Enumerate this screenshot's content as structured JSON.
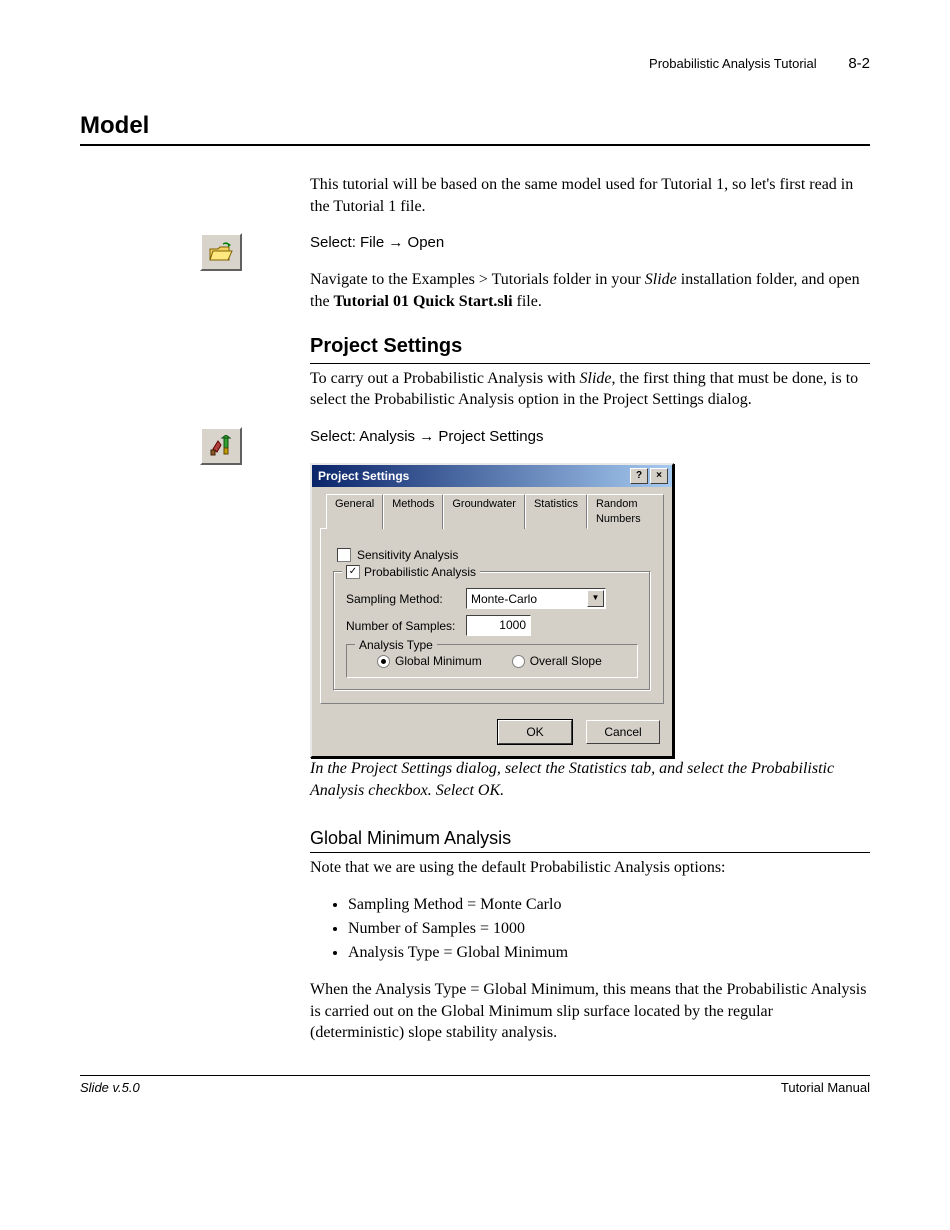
{
  "header": {
    "doc": "Probabilistic Analysis Tutorial",
    "page": "8-2"
  },
  "h1": "Model",
  "intro": "This tutorial will be based on the same model used for Tutorial 1, so let's first read in the Tutorial 1 file.",
  "menu1": "Select: File → Open",
  "nav_pre": "Navigate to the Examples > Tutorials folder in your ",
  "nav_app": "Slide",
  "nav_mid": " installation folder, and open the ",
  "nav_file": "Tutorial 01 Quick Start.sli",
  "nav_post": " file.",
  "h2": "Project Settings",
  "ps_para_pre": "To carry out a Probabilistic Analysis with ",
  "ps_para_app": "Slide",
  "ps_para_post": ", the first thing that must be done, is to select the Probabilistic Analysis option in the Project Settings dialog.",
  "menu2": "Select: Analysis → Project Settings",
  "dialog": {
    "title": "Project Settings",
    "tabs": {
      "t1": "General",
      "t2": "Methods",
      "t3": "Groundwater",
      "t4": "Statistics",
      "t5": "Random Numbers"
    },
    "sensitivity": "Sensitivity Analysis",
    "probabilistic": "Probabilistic Analysis",
    "sampling_label": "Sampling Method:",
    "sampling_value": "Monte-Carlo",
    "samples_label": "Number of Samples:",
    "samples_value": "1000",
    "atype_legend": "Analysis Type",
    "atype_global": "Global Minimum",
    "atype_overall": "Overall Slope",
    "ok": "OK",
    "cancel": "Cancel"
  },
  "caption": "In the Project Settings dialog, select the Statistics tab, and select the Probabilistic Analysis checkbox. Select OK.",
  "h3": "Global Minimum Analysis",
  "gm_note": "Note that we are using the default Probabilistic Analysis options:",
  "bullets": {
    "b1": "Sampling Method = Monte Carlo",
    "b2": "Number of Samples = 1000",
    "b3": "Analysis Type = Global Minimum"
  },
  "gm_para": "When the Analysis Type = Global Minimum, this means that the Probabilistic Analysis is carried out on the Global Minimum slip surface located by the regular (deterministic) slope stability analysis.",
  "footer": {
    "left": "Slide v.5.0",
    "right": "Tutorial Manual"
  }
}
